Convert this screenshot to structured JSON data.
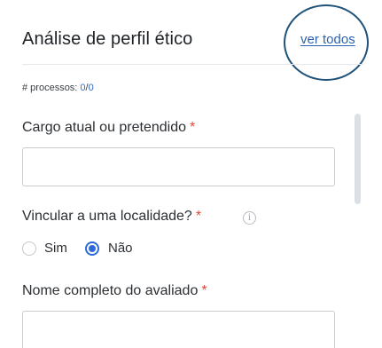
{
  "header": {
    "title": "Análise de perfil ético",
    "see_all_label": "ver todos"
  },
  "counter": {
    "label": "# processos: ",
    "current": "0",
    "separator": "/",
    "total": "0"
  },
  "form": {
    "position_field": {
      "label": "Cargo atual ou pretendido",
      "required_mark": "*",
      "value": ""
    },
    "location_question": {
      "label": "Vincular a uma localidade?",
      "required_mark": "*",
      "info_icon": "info-icon",
      "options": [
        {
          "label": "Sim",
          "selected": false
        },
        {
          "label": "Não",
          "selected": true
        }
      ]
    },
    "name_field": {
      "label": "Nome completo do avaliado",
      "required_mark": "*",
      "value": ""
    }
  },
  "colors": {
    "link": "#2b62b3",
    "required": "#e0463c",
    "radio_selected": "#2e6bd8",
    "highlight_circle": "#1e5278"
  }
}
